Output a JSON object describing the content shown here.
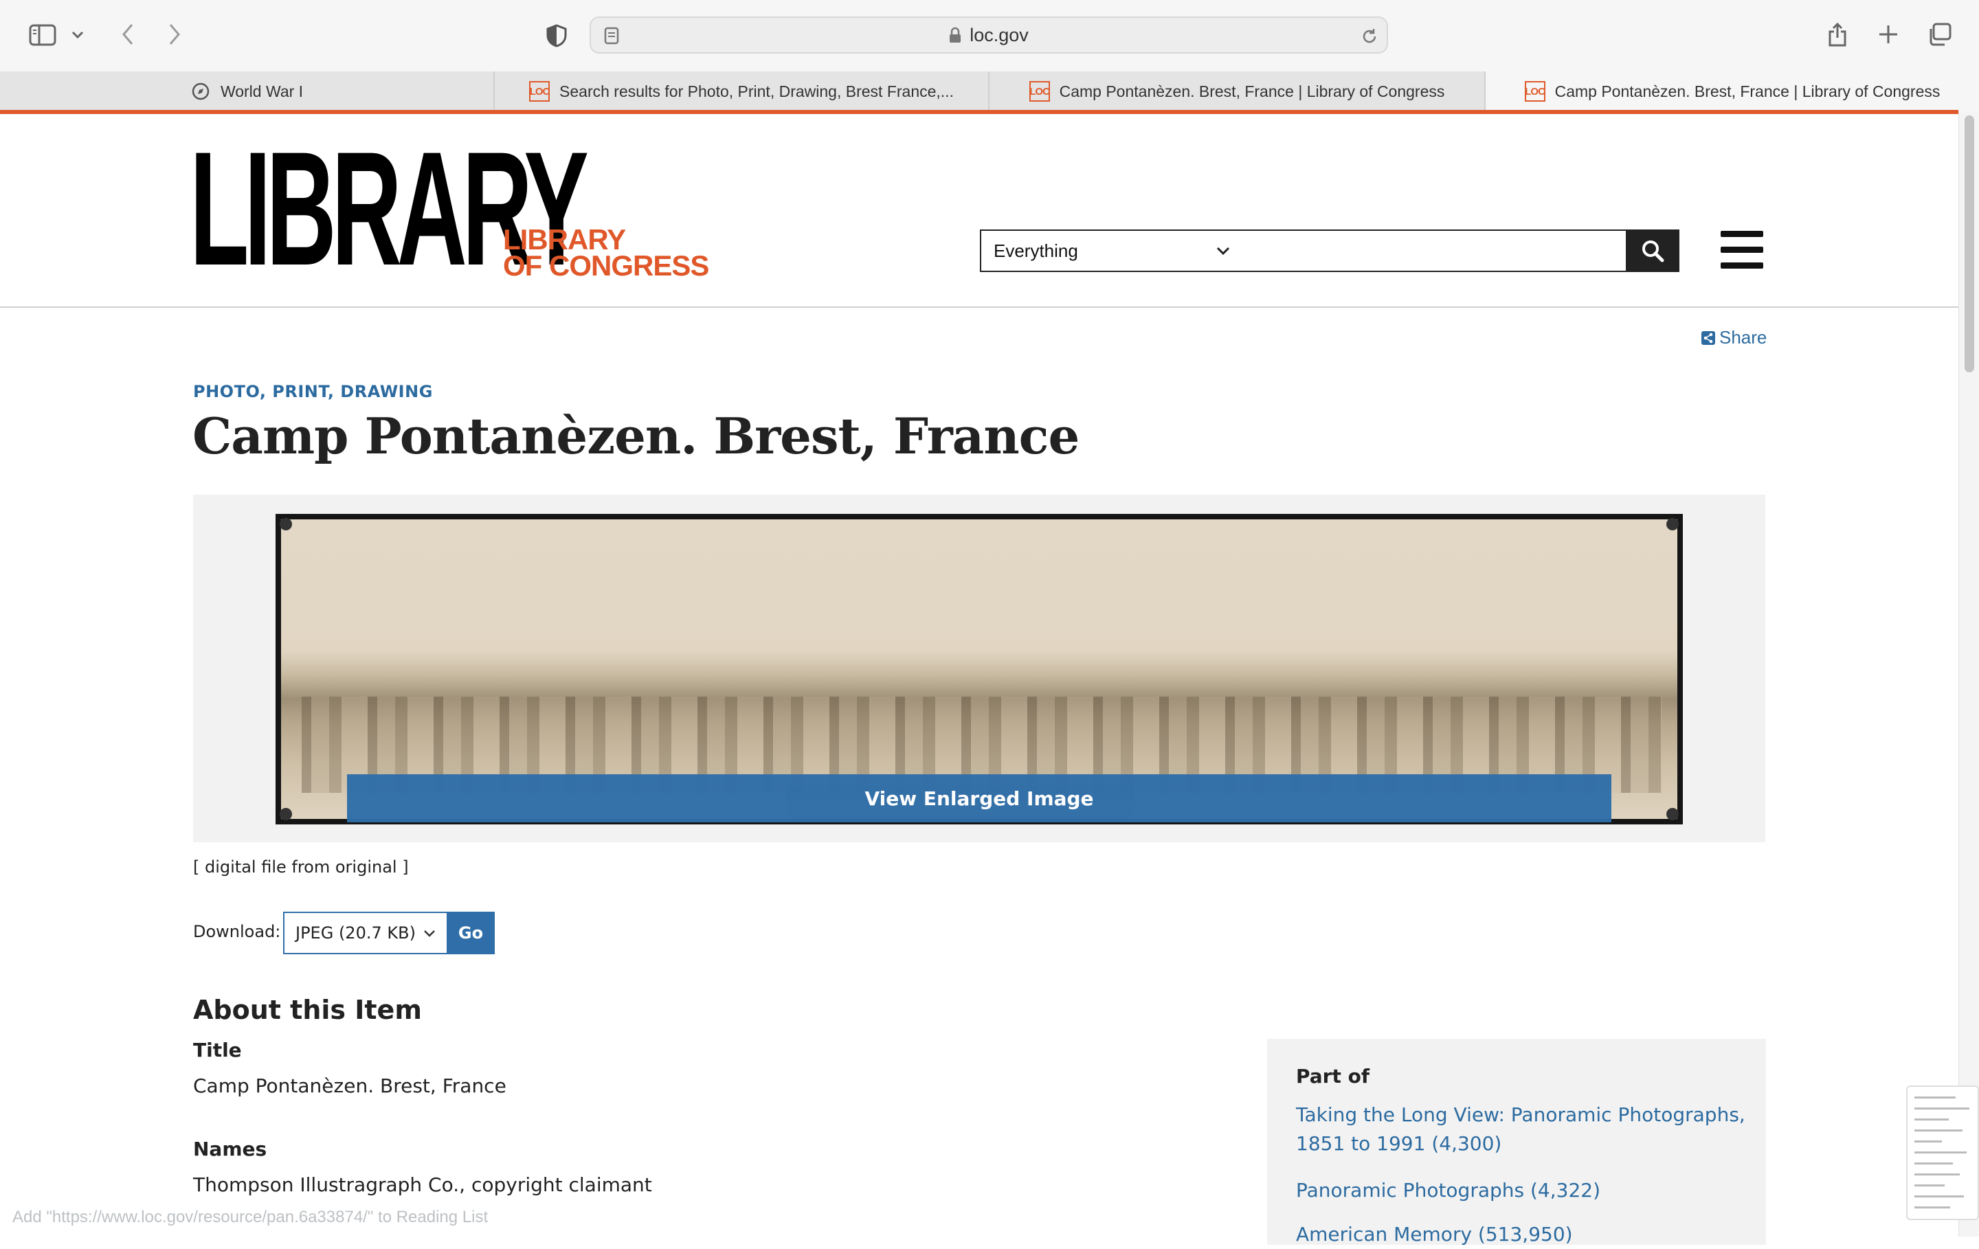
{
  "browser": {
    "address": "loc.gov",
    "tabs": [
      {
        "label": "World War I",
        "icon": "compass-icon",
        "active": false
      },
      {
        "label": "Search results for Photo, Print, Drawing, Brest France,...",
        "icon": "loc-favicon",
        "active": false
      },
      {
        "label": "Camp Pontanèzen. Brest, France | Library of Congress",
        "icon": "loc-favicon",
        "active": false
      },
      {
        "label": "Camp Pontanèzen. Brest, France | Library of Congress",
        "icon": "loc-favicon",
        "active": true
      }
    ],
    "status_url": "Add \"https://www.loc.gov/resource/pan.6a33874/\" to Reading List"
  },
  "site": {
    "logo_big": "LIBRARY",
    "logo_small_line1": "LIBRARY",
    "logo_small_line2": "OF CONGRESS",
    "search_scope": "Everything",
    "search_value": "",
    "accent_color": "#e0582a",
    "link_color": "#2c6ba0"
  },
  "item": {
    "share_label": "Share",
    "format": "PHOTO, PRINT, DRAWING",
    "title": "Camp Pontanèzen. Brest, France",
    "view_button": "View Enlarged Image",
    "caption": "[ digital file from original ]",
    "download_label": "Download:",
    "download_option": "JPEG (20.7 KB)",
    "go_label": "Go"
  },
  "about": {
    "heading": "About this Item",
    "fields": [
      {
        "label": "Title",
        "value": "Camp Pontanèzen. Brest, France"
      },
      {
        "label": "Names",
        "value": "Thompson Illustragraph Co., copyright claimant"
      }
    ],
    "part_of": {
      "heading": "Part of",
      "links": [
        "Taking the Long View: Panoramic Photographs, 1851 to 1991 (4,300)",
        "Panoramic Photographs (4,322)",
        "American Memory (513,950)"
      ]
    }
  }
}
